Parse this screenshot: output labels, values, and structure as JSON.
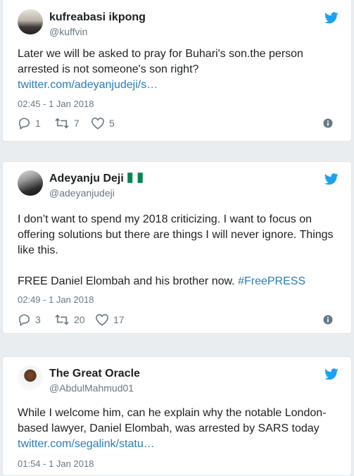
{
  "colors": {
    "link": "#2b7bb9",
    "muted": "#697882",
    "bird": "#1da1f2"
  },
  "tweets": [
    {
      "name": "kufreabasi ikpong",
      "handle": "@kuffvin",
      "text": "Later we will be asked to pray for Buhari's son.the person arrested is not someone's son right?",
      "link": "twitter.com/adeyanjudeji/s…",
      "time": "02:45 - 1 Jan 2018",
      "replies": "1",
      "retweets": "7",
      "likes": "5"
    },
    {
      "name": "Adeyanju Deji",
      "handle": "@adeyanjudeji",
      "text": "I don’t want to spend my 2018 criticizing. I want to focus on offering solutions but there are things I will never ignore. Things like this.\n\nFREE Daniel Elombah and his brother now. ",
      "hashtag": "#FreePRESS",
      "time": "02:49 - 1 Jan 2018",
      "replies": "3",
      "retweets": "20",
      "likes": "17"
    },
    {
      "name": "The Great Oracle",
      "handle": "@AbdulMahmud01",
      "text": "While I welcome him, can he explain why the notable London-based lawyer, Daniel Elombah, was arrested by SARS today",
      "link": "twitter.com/segalink/statu…",
      "time": "01:54 - 1 Jan 2018"
    }
  ]
}
